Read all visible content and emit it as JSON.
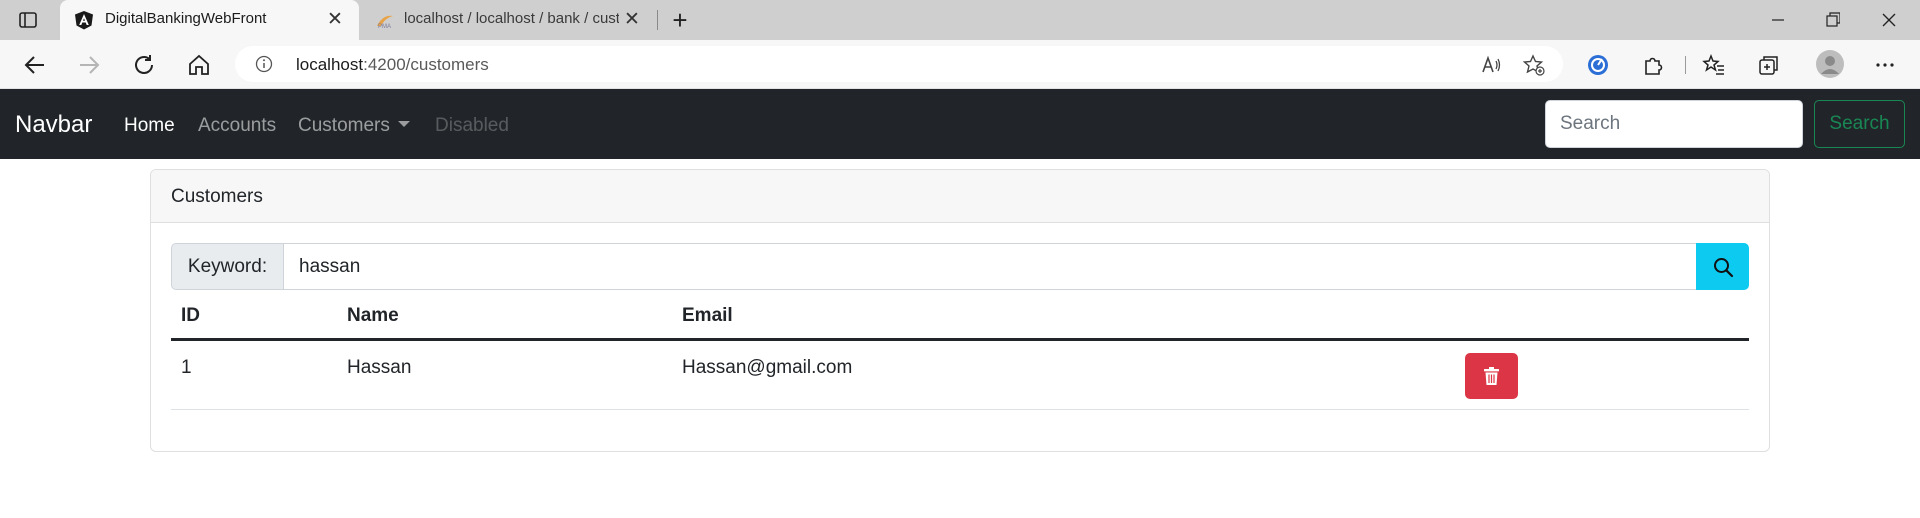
{
  "browser": {
    "tabs": [
      {
        "title": "DigitalBankingWebFront",
        "active": true
      },
      {
        "title": "localhost / localhost / bank / customer | phpMyAdmin",
        "active": false
      }
    ],
    "url_host": "localhost",
    "url_path": ":4200/customers"
  },
  "navbar": {
    "brand": "Navbar",
    "links": [
      "Home",
      "Accounts",
      "Customers",
      "Disabled"
    ],
    "search_placeholder": "Search",
    "search_button": "Search"
  },
  "card": {
    "title": "Customers",
    "keyword_label": "Keyword:",
    "keyword_value": "hassan"
  },
  "table": {
    "columns": [
      "ID",
      "Name",
      "Email"
    ],
    "rows": [
      {
        "id": "1",
        "name": "Hassan",
        "email": "Hassan@gmail.com"
      }
    ]
  },
  "colors": {
    "navbar_bg": "#212529",
    "search_btn": "#198754",
    "info_btn": "#0dcaf0",
    "danger_btn": "#dc3545"
  },
  "icons": {
    "search_button_icon": "search-icon",
    "delete_button_icon": "trash-icon"
  }
}
